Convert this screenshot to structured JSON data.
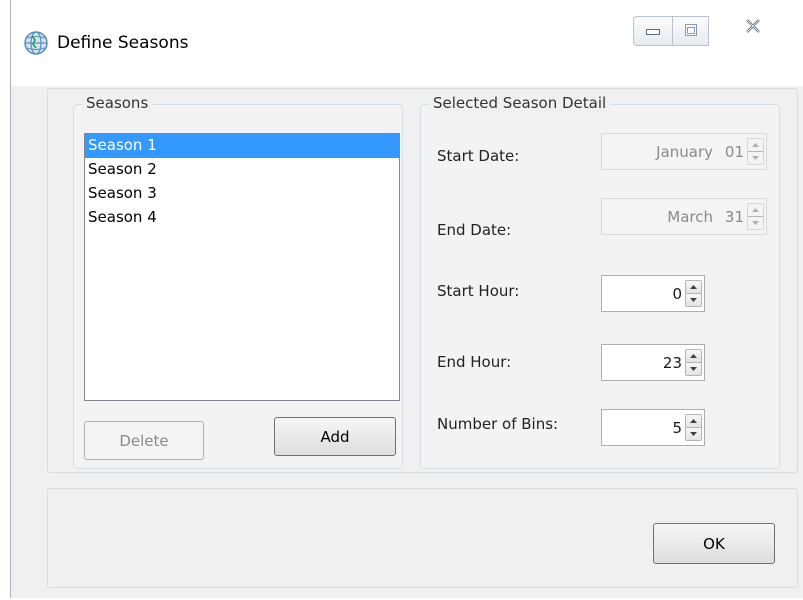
{
  "window": {
    "title": "Define Seasons"
  },
  "seasons": {
    "legend": "Seasons",
    "items": [
      "Season 1",
      "Season 2",
      "Season 3",
      "Season 4"
    ],
    "selected_index": 0,
    "delete_label": "Delete",
    "add_label": "Add"
  },
  "detail": {
    "legend": "Selected Season Detail",
    "start_date": {
      "label": "Start Date:",
      "month": "January",
      "day": "01"
    },
    "end_date": {
      "label": "End Date:",
      "month": "March",
      "day": "31"
    },
    "start_hour": {
      "label": "Start Hour:",
      "value": "0"
    },
    "end_hour": {
      "label": "End Hour:",
      "value": "23"
    },
    "bins": {
      "label": "Number of Bins:",
      "value": "5"
    }
  },
  "footer": {
    "ok_label": "OK"
  },
  "colors": {
    "selection": "#3399ff",
    "background": "#f0f0f0"
  },
  "icons": {
    "app": "globe-icon",
    "minimize": "minimize-icon",
    "maximize": "maximize-icon",
    "close": "close-icon",
    "spin_up": "chevron-up-icon",
    "spin_down": "chevron-down-icon"
  }
}
